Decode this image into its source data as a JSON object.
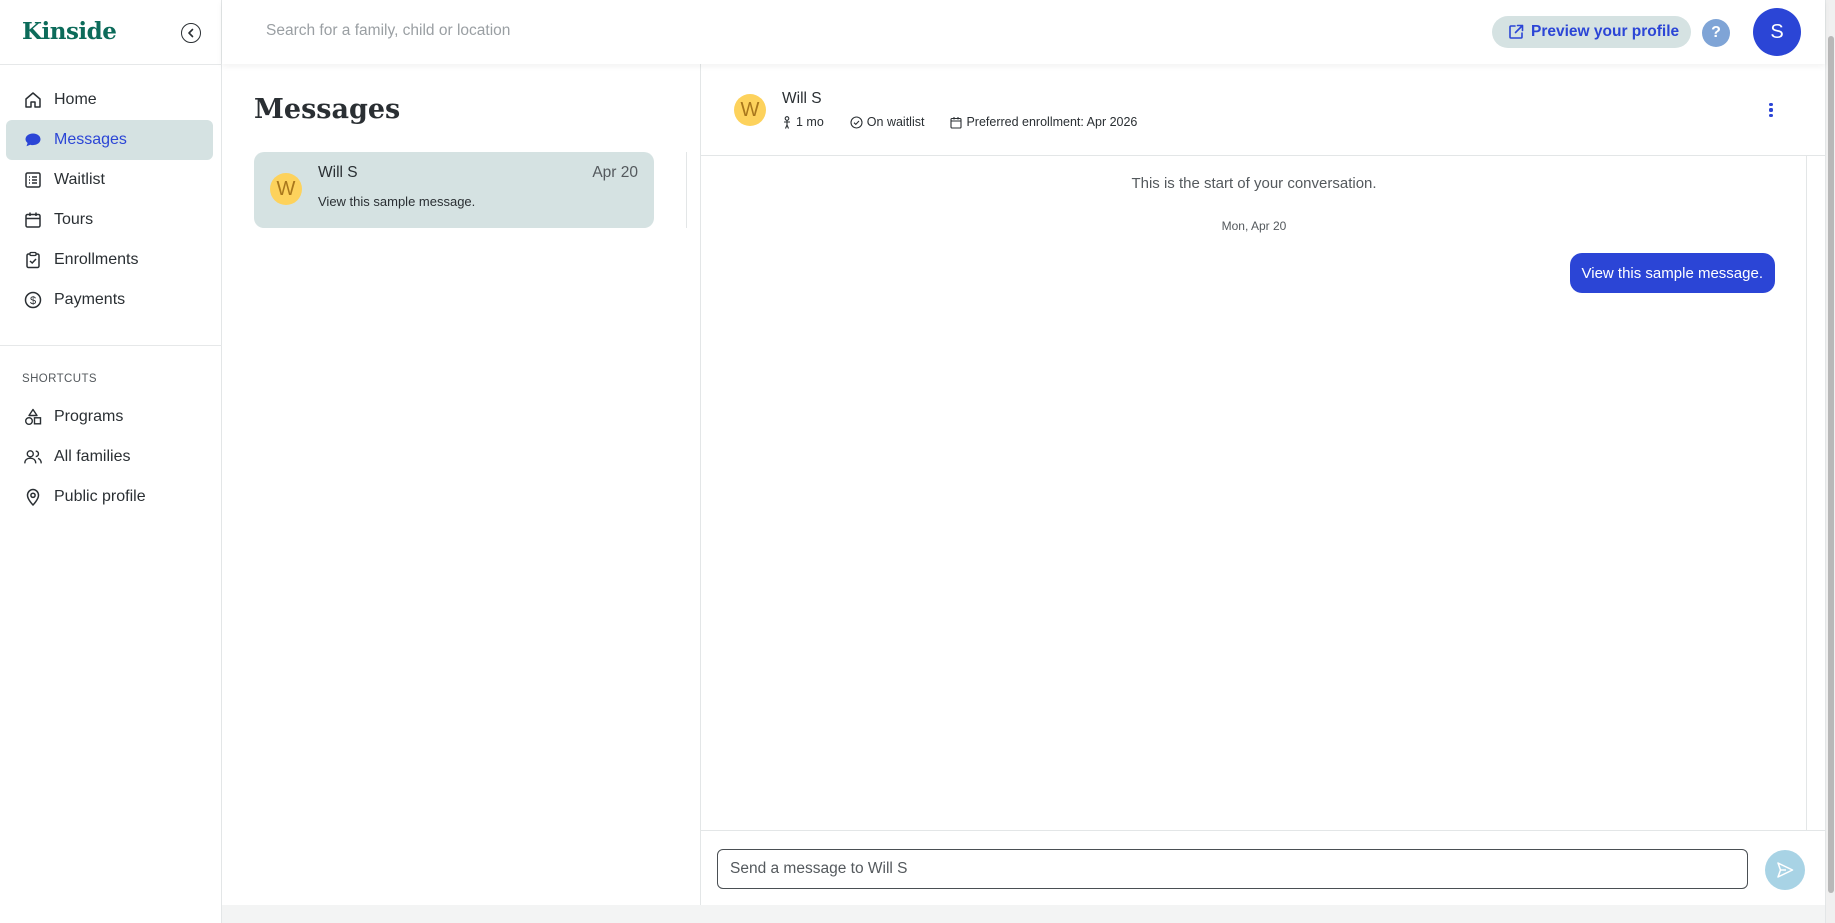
{
  "brand": {
    "name": "Kinside"
  },
  "colors": {
    "brand": "#0c6b5a",
    "accent": "#2b45d6",
    "active_bg": "#d5e2e2",
    "avatar_yellow": "#fdd25c"
  },
  "search": {
    "placeholder": "Search for a family, child or location",
    "icon": "none"
  },
  "topbar": {
    "preview_label": "Preview your profile",
    "help_label": "?",
    "user_initial": "S"
  },
  "sidebar": {
    "items": [
      {
        "label": "Home",
        "icon": "home-icon"
      },
      {
        "label": "Messages",
        "icon": "chat-bubble-icon",
        "active": true
      },
      {
        "label": "Waitlist",
        "icon": "list-icon"
      },
      {
        "label": "Tours",
        "icon": "calendar-icon"
      },
      {
        "label": "Enrollments",
        "icon": "clipboard-check-icon"
      },
      {
        "label": "Payments",
        "icon": "dollar-icon"
      }
    ],
    "shortcuts_title": "SHORTCUTS",
    "shortcuts": [
      {
        "label": "Programs",
        "icon": "shapes-icon"
      },
      {
        "label": "All families",
        "icon": "users-icon"
      },
      {
        "label": "Public profile",
        "icon": "map-pin-icon"
      }
    ]
  },
  "messages": {
    "title": "Messages",
    "conversations": [
      {
        "initial": "W",
        "name": "Will S",
        "date": "Apr 20",
        "preview": "View this sample message."
      }
    ]
  },
  "thread": {
    "initial": "W",
    "name": "Will S",
    "age": "1 mo",
    "status": "On waitlist",
    "enrollment": "Preferred enrollment: Apr 2026",
    "start_text": "This is the start of your conversation.",
    "day_label": "Mon, Apr 20",
    "messages": [
      {
        "text": "View this sample message.",
        "from": "me"
      }
    ],
    "composer_placeholder": "Send a message to Will S"
  }
}
